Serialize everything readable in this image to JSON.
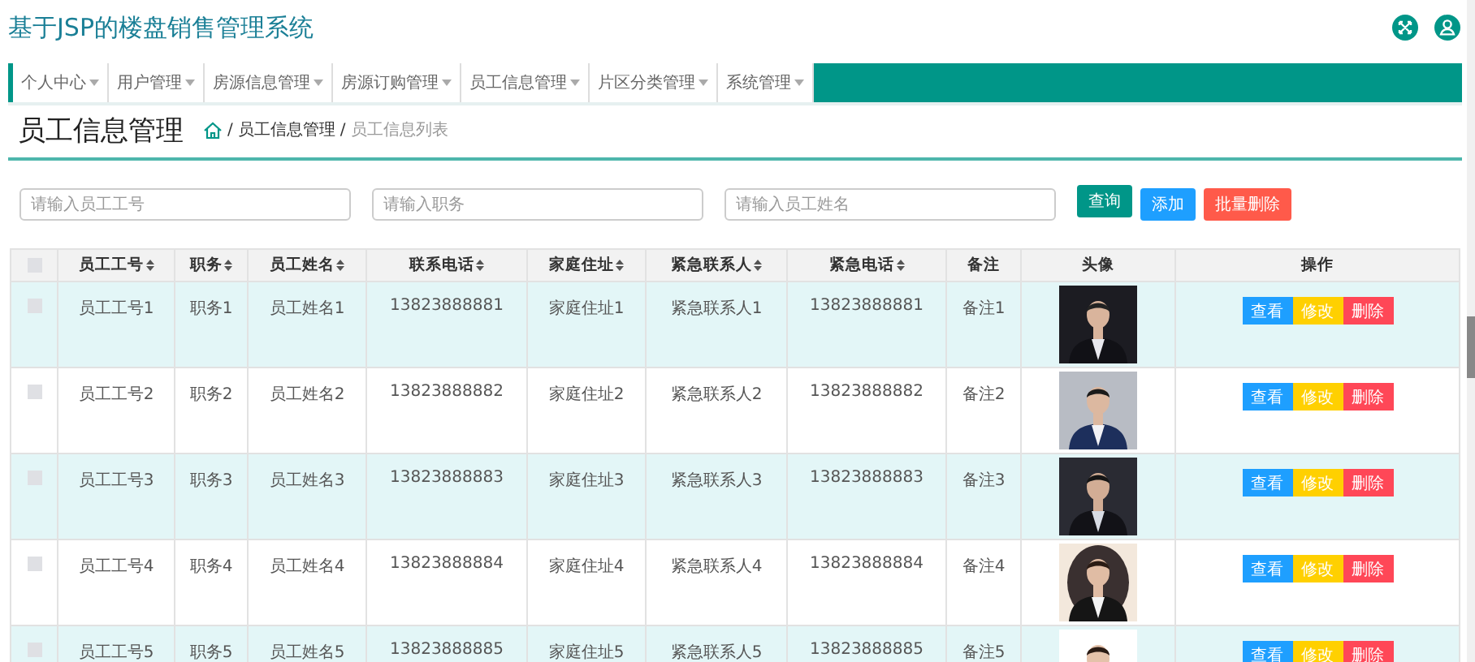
{
  "header": {
    "title": "基于JSP的楼盘销售管理系统"
  },
  "nav": [
    {
      "label": "个人中心",
      "dropdown": true
    },
    {
      "label": "用户管理",
      "dropdown": true
    },
    {
      "label": "房源信息管理",
      "dropdown": true
    },
    {
      "label": "房源订购管理",
      "dropdown": true
    },
    {
      "label": "员工信息管理",
      "dropdown": true
    },
    {
      "label": "片区分类管理",
      "dropdown": true
    },
    {
      "label": "系统管理",
      "dropdown": true
    }
  ],
  "page": {
    "heading": "员工信息管理",
    "breadcrumb_separator": "/",
    "breadcrumb": [
      "员工信息管理",
      "员工信息列表"
    ]
  },
  "search": {
    "fields": [
      {
        "placeholder": "请输入员工工号"
      },
      {
        "placeholder": "请输入职务"
      },
      {
        "placeholder": "请输入员工姓名"
      }
    ],
    "buttons": [
      {
        "label": "查询",
        "kind": "query"
      },
      {
        "label": "添加",
        "kind": "add"
      },
      {
        "label": "批量删除",
        "kind": "batch_delete"
      }
    ]
  },
  "table": {
    "select_all_checked": false,
    "columns": [
      {
        "label": "员工工号",
        "sortable": true
      },
      {
        "label": "职务",
        "sortable": true
      },
      {
        "label": "员工姓名",
        "sortable": true
      },
      {
        "label": "联系电话",
        "sortable": true
      },
      {
        "label": "家庭住址",
        "sortable": true
      },
      {
        "label": "紧急联系人",
        "sortable": true
      },
      {
        "label": "紧急电话",
        "sortable": true
      },
      {
        "label": "备注",
        "sortable": false
      },
      {
        "label": "头像",
        "sortable": false
      },
      {
        "label": "操作",
        "sortable": false
      }
    ],
    "rows": [
      {
        "checked": false,
        "cells": [
          "员工工号1",
          "职务1",
          "员工姓名1",
          "13823888881",
          "家庭住址1",
          "紧急联系人1",
          "13823888881",
          "备注1"
        ],
        "actions": [
          {
            "label": "查看",
            "kind": "view"
          },
          {
            "label": "修改",
            "kind": "edit"
          },
          {
            "label": "删除",
            "kind": "delete"
          }
        ]
      },
      {
        "checked": false,
        "cells": [
          "员工工号2",
          "职务2",
          "员工姓名2",
          "13823888882",
          "家庭住址2",
          "紧急联系人2",
          "13823888882",
          "备注2"
        ],
        "actions": [
          {
            "label": "查看",
            "kind": "view"
          },
          {
            "label": "修改",
            "kind": "edit"
          },
          {
            "label": "删除",
            "kind": "delete"
          }
        ]
      },
      {
        "checked": false,
        "cells": [
          "员工工号3",
          "职务3",
          "员工姓名3",
          "13823888883",
          "家庭住址3",
          "紧急联系人3",
          "13823888883",
          "备注3"
        ],
        "actions": [
          {
            "label": "查看",
            "kind": "view"
          },
          {
            "label": "修改",
            "kind": "edit"
          },
          {
            "label": "删除",
            "kind": "delete"
          }
        ]
      },
      {
        "checked": false,
        "cells": [
          "员工工号4",
          "职务4",
          "员工姓名4",
          "13823888884",
          "家庭住址4",
          "紧急联系人4",
          "13823888884",
          "备注4"
        ],
        "actions": [
          {
            "label": "查看",
            "kind": "view"
          },
          {
            "label": "修改",
            "kind": "edit"
          },
          {
            "label": "删除",
            "kind": "delete"
          }
        ]
      },
      {
        "checked": false,
        "cells": [
          "员工工号5",
          "职务5",
          "员工姓名5",
          "13823888885",
          "家庭住址5",
          "紧急联系人5",
          "13823888885",
          "备注5"
        ],
        "actions": [
          {
            "label": "查看",
            "kind": "view"
          },
          {
            "label": "修改",
            "kind": "edit"
          },
          {
            "label": "删除",
            "kind": "delete"
          }
        ]
      }
    ]
  }
}
